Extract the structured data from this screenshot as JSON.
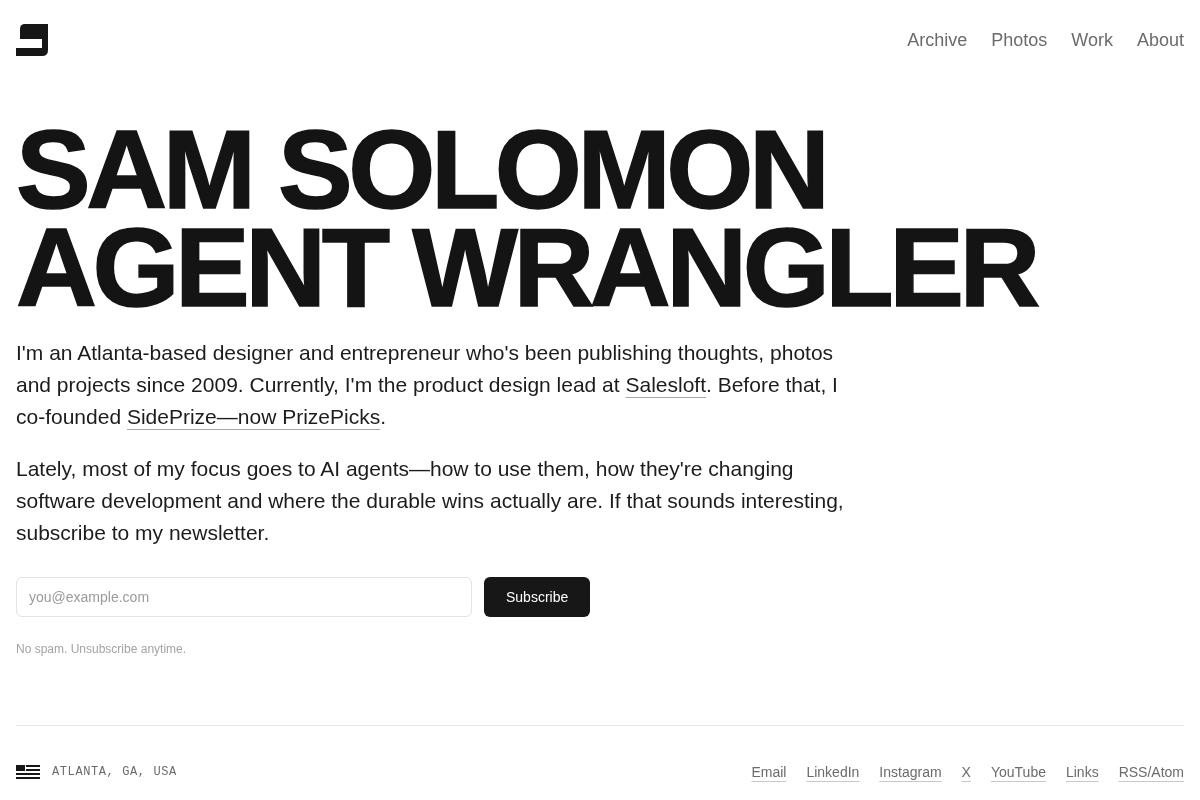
{
  "header": {
    "nav": [
      {
        "label": "Archive"
      },
      {
        "label": "Photos"
      },
      {
        "label": "Work"
      },
      {
        "label": "About"
      }
    ]
  },
  "hero": {
    "title_lines": [
      "SAM SOLOMON",
      "AGENT WRANGLER"
    ]
  },
  "intro": {
    "paragraphs": [
      {
        "segments": [
          {
            "kind": "text",
            "text": "I'm an Atlanta-based designer and entrepreneur who's been publishing thoughts, photos and projects since 2009. Currently, I'm the product design lead at "
          },
          {
            "kind": "link",
            "text": "Salesloft"
          },
          {
            "kind": "text",
            "text": ". Before that, I co-founded "
          },
          {
            "kind": "link",
            "text": "SidePrize—now PrizePicks"
          },
          {
            "kind": "text",
            "text": "."
          }
        ]
      },
      {
        "segments": [
          {
            "kind": "text",
            "text": "Lately, most of my focus goes to AI agents—how to use them, how they're changing software development and where the durable wins actually are. If that sounds interesting, subscribe to my newsletter."
          }
        ]
      }
    ]
  },
  "newsletter": {
    "email_field": {
      "placeholder": "you@example.com"
    },
    "button": "Subscribe",
    "note": "No spam. Unsubscribe anytime."
  },
  "footer": {
    "location": "ATLANTA, GA, USA",
    "links": [
      "Email",
      "LinkedIn",
      "Instagram",
      "X",
      "YouTube",
      "Links",
      "RSS/Atom"
    ]
  }
}
